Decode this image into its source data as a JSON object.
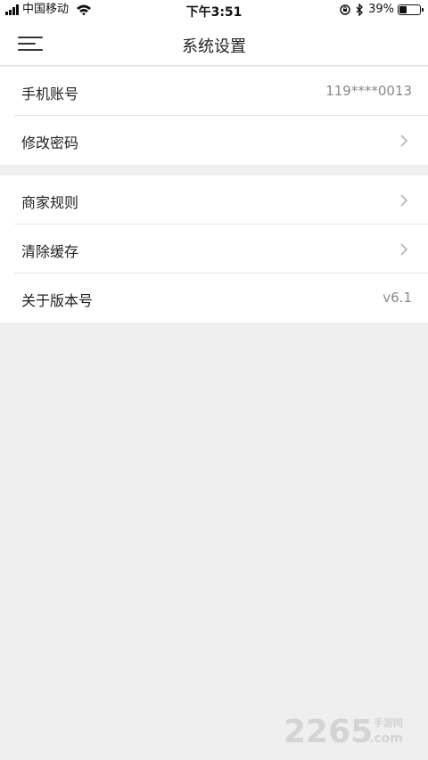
{
  "status_bar": {
    "carrier": "中国移动",
    "time": "下午3:51",
    "battery_percent": "39%",
    "battery_level": 0.39
  },
  "nav": {
    "title": "系统设置",
    "menu_icon": "menu-icon"
  },
  "settings": {
    "group1": [
      {
        "label": "手机账号",
        "value": "119****0013",
        "has_chevron": false
      },
      {
        "label": "修改密码",
        "value": "",
        "has_chevron": true
      }
    ],
    "group2": [
      {
        "label": "商家规则",
        "value": "",
        "has_chevron": true
      },
      {
        "label": "清除缓存",
        "value": "",
        "has_chevron": true
      },
      {
        "label": "关于版本号",
        "value": "v6.1",
        "has_chevron": false
      }
    ]
  },
  "watermark": {
    "text": "2265.com 手游网"
  },
  "colors": {
    "background": "#efefef",
    "row_bg": "#ffffff",
    "divider": "#e6e6e6",
    "secondary_text": "#888888"
  }
}
